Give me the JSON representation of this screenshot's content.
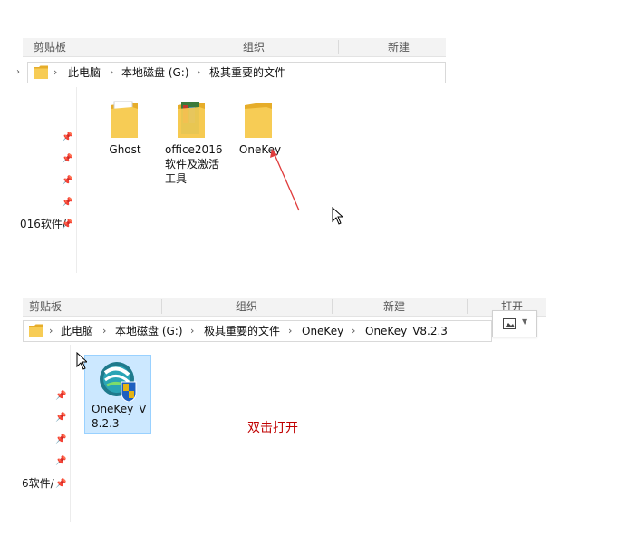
{
  "top": {
    "ribbon": {
      "clipboard": "剪贴板",
      "organize": "组织",
      "new": "新建"
    },
    "breadcrumb": [
      "此电脑",
      "本地磁盘 (G:)",
      "极其重要的文件"
    ],
    "sidebar_partial": "016软件/",
    "items": [
      {
        "label": "Ghost"
      },
      {
        "label": "office2016软件及激活工具"
      },
      {
        "label": "OneKey"
      }
    ]
  },
  "bottom": {
    "ribbon": {
      "clipboard": "剪贴板",
      "organize": "组织",
      "new": "新建",
      "open": "打开"
    },
    "breadcrumb": [
      "此电脑",
      "本地磁盘 (G:)",
      "极其重要的文件",
      "OneKey",
      "OneKey_V8.2.3"
    ],
    "sidebar_partial": "6软件/",
    "items": [
      {
        "label_line1": "OneKey_V",
        "label_line2": "8.2.3"
      }
    ]
  },
  "annotation": {
    "text": "双击打开",
    "color": "#c00000"
  },
  "colors": {
    "folder": "#f5c542",
    "folder_dark": "#e6ad2a",
    "arrow": "#e03c3c",
    "selection": "#cce8ff"
  }
}
